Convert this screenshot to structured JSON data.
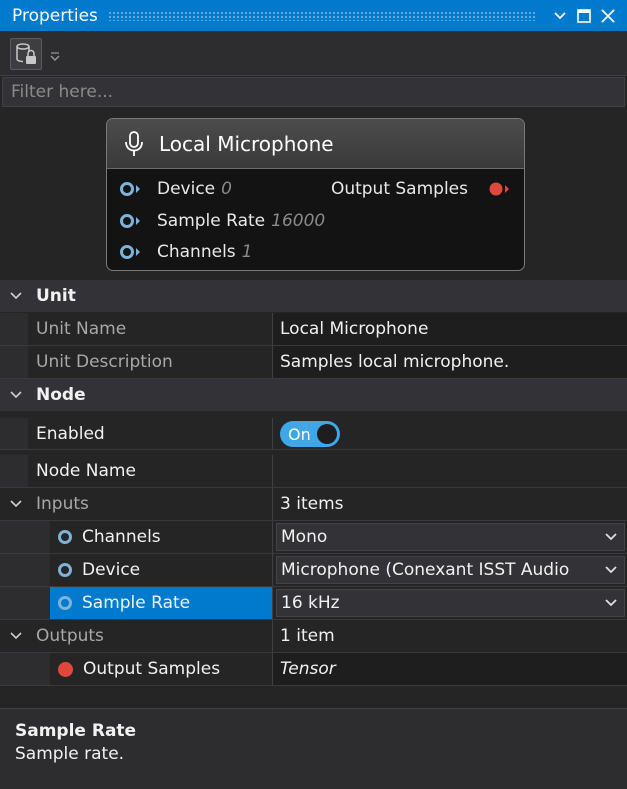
{
  "window": {
    "title": "Properties"
  },
  "filter": {
    "placeholder": "Filter here..."
  },
  "node_preview": {
    "title": "Local Microphone",
    "inputs": [
      {
        "label": "Device",
        "value": "0"
      },
      {
        "label": "Sample Rate",
        "value": "16000"
      },
      {
        "label": "Channels",
        "value": "1"
      }
    ],
    "output": {
      "label": "Output Samples"
    }
  },
  "sections": {
    "unit": {
      "title": "Unit",
      "unit_name_label": "Unit Name",
      "unit_name_value": "Local Microphone",
      "unit_desc_label": "Unit Description",
      "unit_desc_value": "Samples local microphone."
    },
    "node": {
      "title": "Node",
      "enabled_label": "Enabled",
      "enabled_value": "On",
      "node_name_label": "Node Name",
      "node_name_value": "",
      "inputs_label": "Inputs",
      "inputs_count": "3 items",
      "inputs": [
        {
          "label": "Channels",
          "value": "Mono"
        },
        {
          "label": "Device",
          "value": "Microphone (Conexant ISST Audio"
        },
        {
          "label": "Sample Rate",
          "value": "16 kHz"
        }
      ],
      "outputs_label": "Outputs",
      "outputs_count": "1 item",
      "outputs": [
        {
          "label": "Output Samples",
          "value": "Tensor"
        }
      ]
    }
  },
  "description": {
    "title": "Sample Rate",
    "text": "Sample rate."
  },
  "colors": {
    "accent": "#007acc",
    "toggle_on": "#3fa7e8",
    "output_pin": "#e0483e",
    "input_pin": "#7fb2d8"
  }
}
